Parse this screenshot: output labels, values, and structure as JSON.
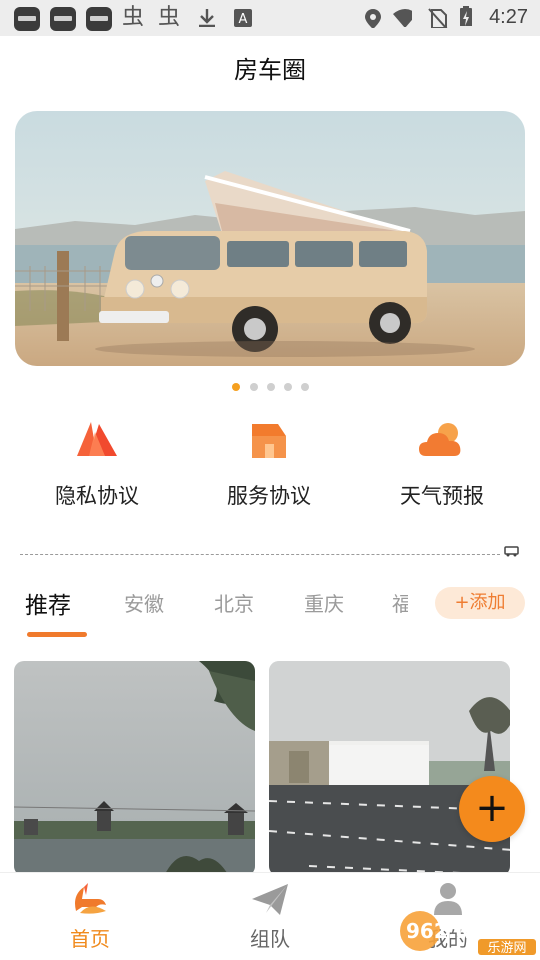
{
  "status_bar": {
    "time": "4:27",
    "notification_icons": [
      "app-icon",
      "app-icon",
      "app-icon",
      "bug-icon",
      "bug-icon",
      "download-icon",
      "a-icon"
    ],
    "system_icons": [
      "location-icon",
      "wifi-icon",
      "no-sim-icon",
      "battery-charging-icon"
    ]
  },
  "header": {
    "title": "房车圈"
  },
  "banner": {
    "active_index": 0,
    "count": 5
  },
  "quick_entries": [
    {
      "label": "隐私协议",
      "icon": "privacy-triangle-icon",
      "color": "#f05a3a"
    },
    {
      "label": "服务协议",
      "icon": "service-house-icon",
      "color": "#f27b2d"
    },
    {
      "label": "天气预报",
      "icon": "weather-cloud-icon",
      "color": "#f2892f"
    }
  ],
  "tabs": {
    "items": [
      "推荐",
      "安徽",
      "北京",
      "重庆"
    ],
    "partial_item": "福",
    "active": "推荐",
    "add_label": "+添加"
  },
  "fab": {
    "label": "+"
  },
  "bottom_nav": [
    {
      "label": "首页",
      "icon": "home-logo-icon",
      "active": true
    },
    {
      "label": "组队",
      "icon": "paper-plane-icon",
      "active": false
    },
    {
      "label": "我的",
      "icon": "profile-icon",
      "active": false
    }
  ],
  "watermark": {
    "text": "962.NET",
    "subtext": "乐游网"
  },
  "colors": {
    "accent": "#f48a1c",
    "tab_underline": "#f07a2c",
    "add_bg": "#fde9d7"
  }
}
